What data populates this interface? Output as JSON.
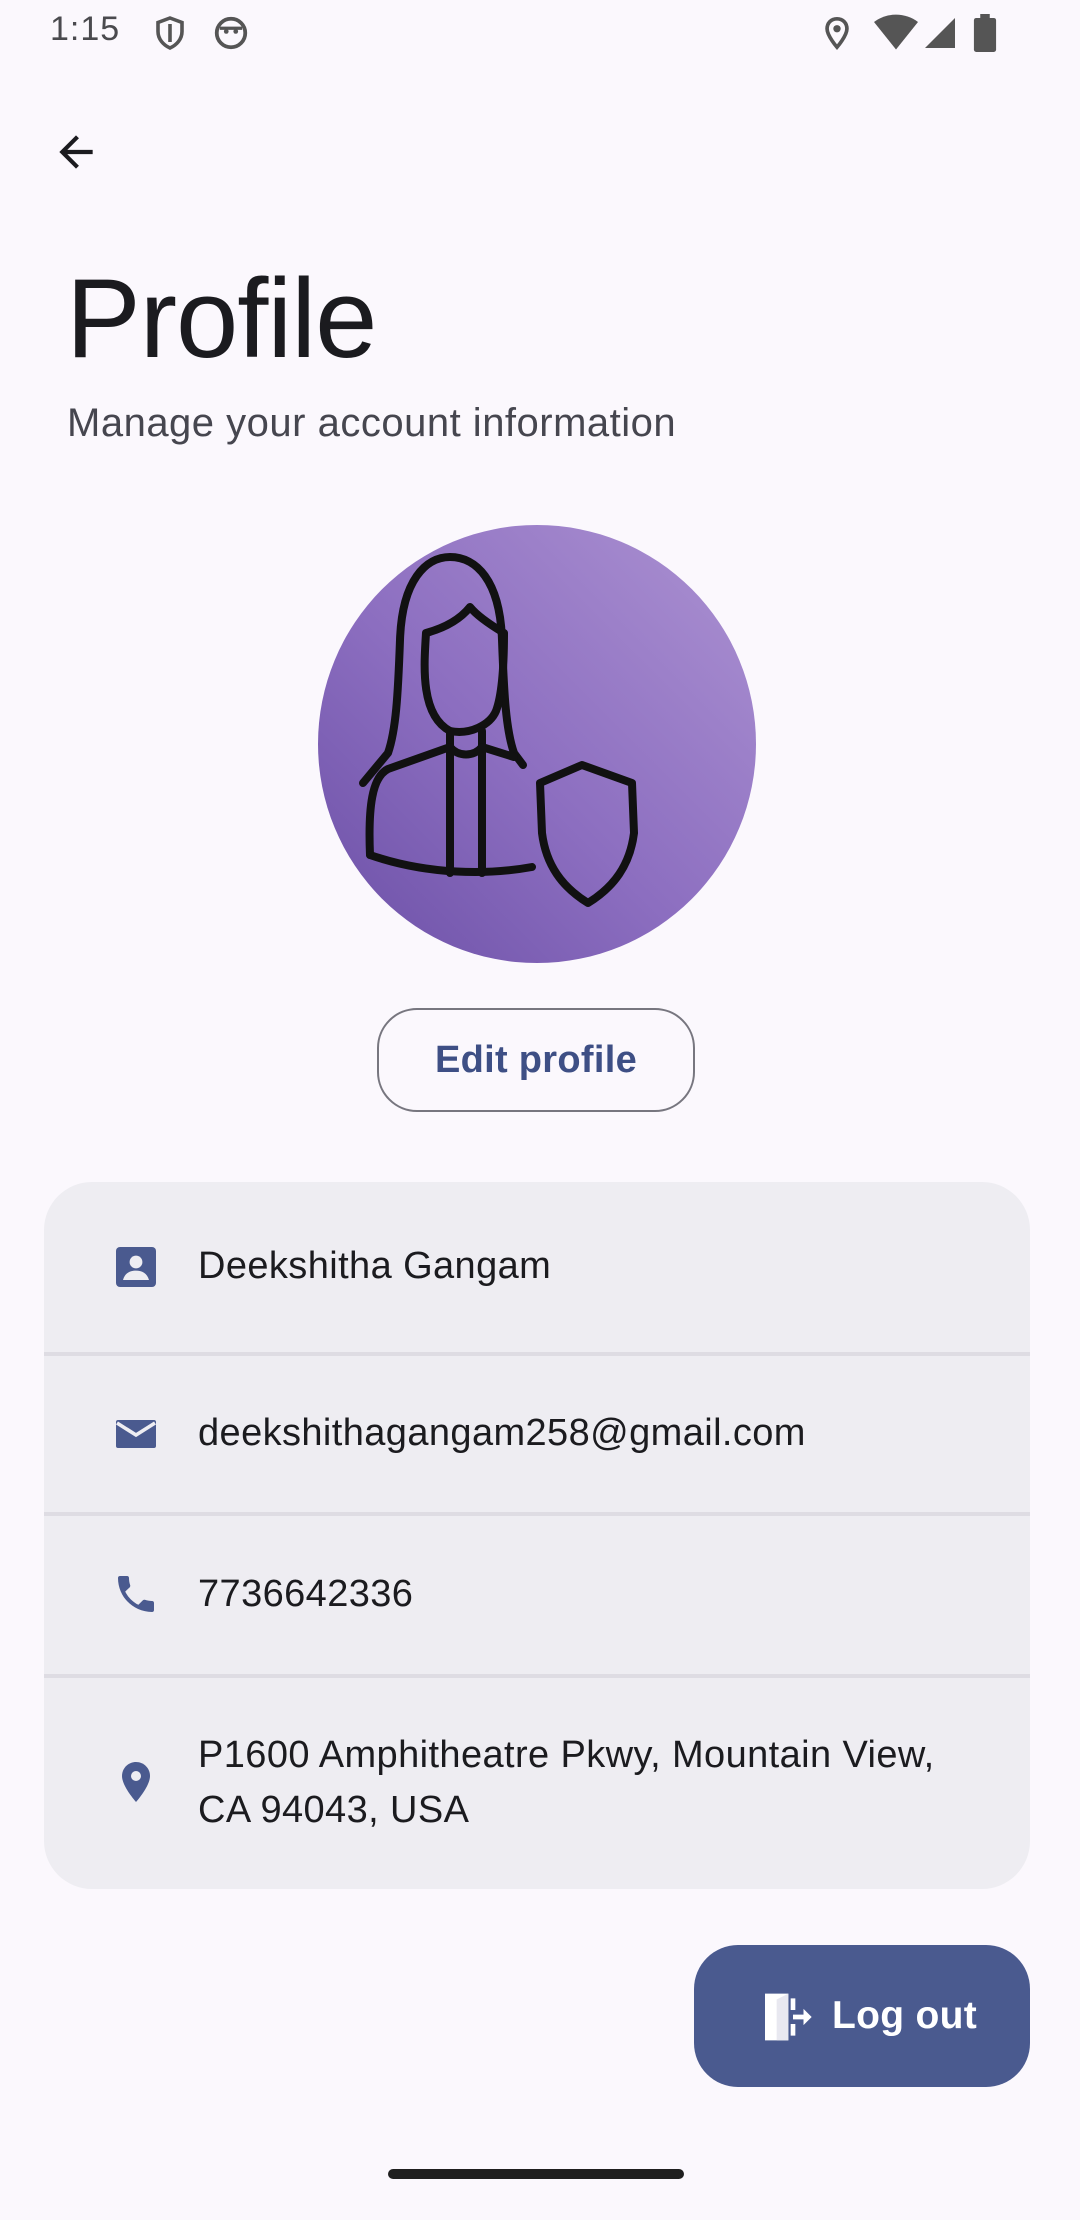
{
  "status_bar": {
    "time": "1:15",
    "icons": [
      "shield-icon",
      "android-icon",
      "location-icon",
      "wifi-icon",
      "signal-icon",
      "battery-icon"
    ]
  },
  "header": {
    "back_icon": "arrow-back-icon",
    "title": "Profile",
    "subtitle": "Manage your account information"
  },
  "avatar": {
    "icon": "woman-with-shield-icon",
    "gradient_colors": [
      "#AC92D2",
      "#6B4FA6"
    ]
  },
  "actions": {
    "edit_profile_label": "Edit profile",
    "logout_label": "Log out"
  },
  "profile": {
    "rows": [
      {
        "icon": "contact-card-icon",
        "value": "Deekshitha Gangam"
      },
      {
        "icon": "email-icon",
        "value": "deekshithagangam258@gmail.com"
      },
      {
        "icon": "phone-icon",
        "value": "7736642336"
      },
      {
        "icon": "location-pin-icon",
        "value": "P1600 Amphitheatre Pkwy, Mountain View, CA 94043, USA"
      }
    ]
  },
  "colors": {
    "primary": "#4A5A8F",
    "icon_tint": "#4A5A8F",
    "card_background": "#EEEDF2",
    "page_background": "#FBF8FD"
  }
}
